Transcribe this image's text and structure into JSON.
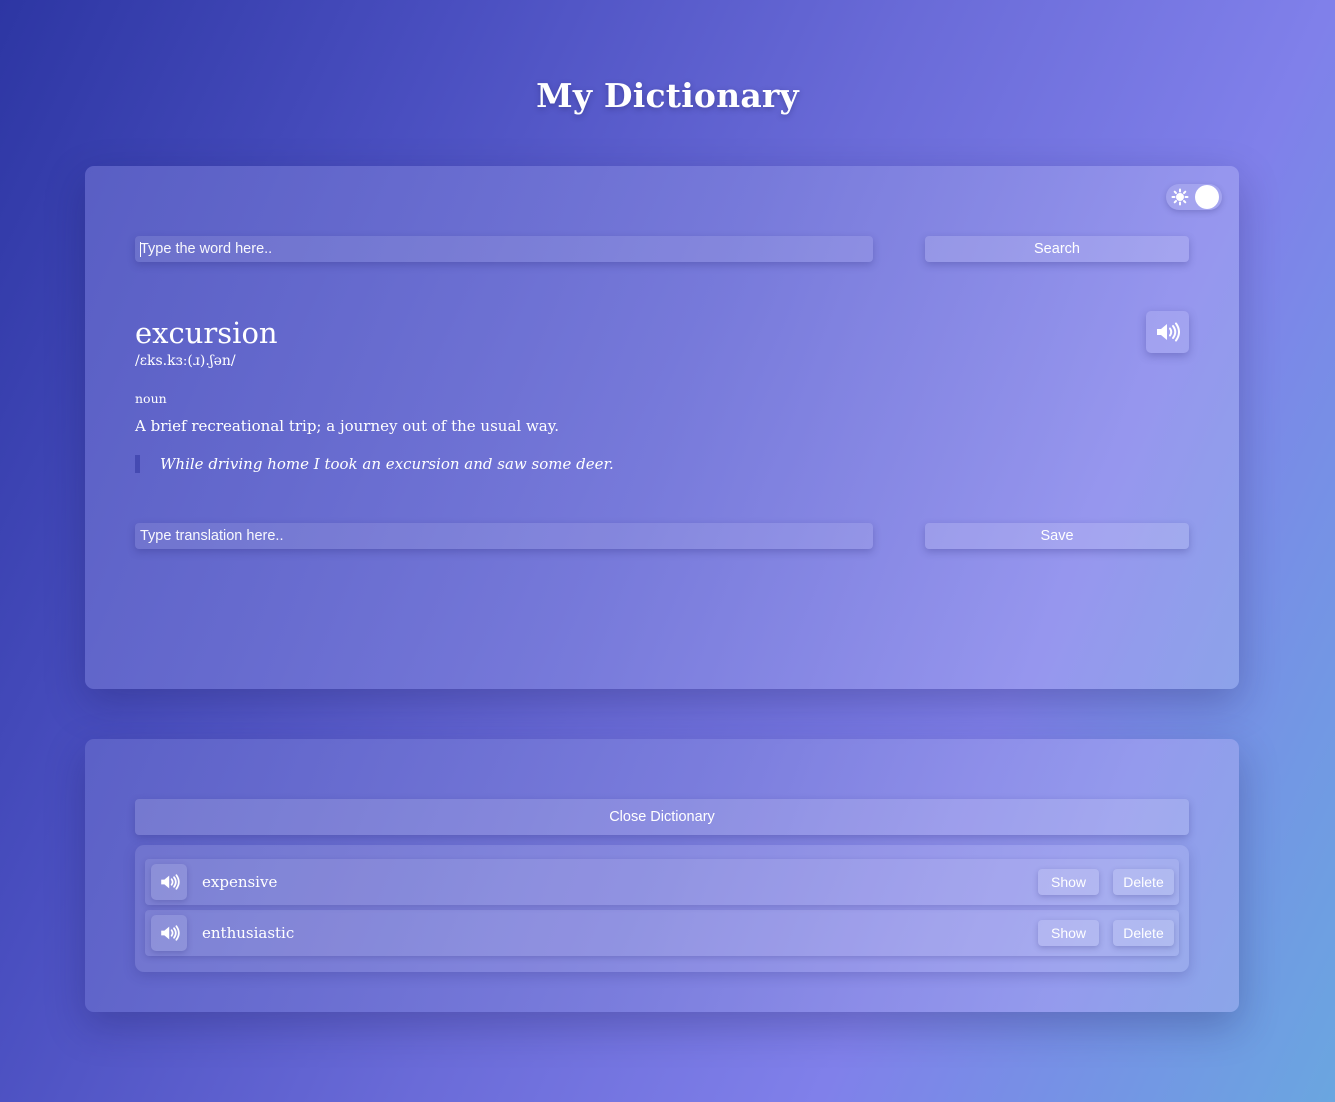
{
  "app": {
    "title": "My Dictionary"
  },
  "search": {
    "placeholder": "Type the word here..",
    "button_label": "Search"
  },
  "theme_toggle": {
    "icon": "sun-icon",
    "state": "on"
  },
  "entry": {
    "word": "excursion",
    "phonetic": "/ɛks.kɜː(ɹ).ʃən/",
    "part_of_speech": "noun",
    "definition": "A brief recreational trip; a journey out of the usual way.",
    "example": "While driving home I took an excursion and saw some deer.",
    "audio_icon": "speaker-icon"
  },
  "translation": {
    "placeholder": "Type translation here..",
    "button_label": "Save"
  },
  "saved": {
    "close_label": "Close Dictionary",
    "items": [
      {
        "word": "expensive",
        "show_label": "Show",
        "delete_label": "Delete"
      },
      {
        "word": "enthusiastic",
        "show_label": "Show",
        "delete_label": "Delete"
      }
    ]
  }
}
